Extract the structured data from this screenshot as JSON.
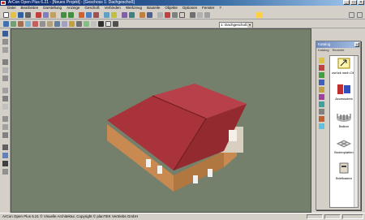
{
  "window": {
    "title": "ArCon Open Plus 6.21 - [Neues Projekt] - [Geschoss 1: Dachgeschoß]"
  },
  "menu": [
    "Datei",
    "Bearbeiten",
    "Darstellung",
    "Anzeige",
    "Geschoß",
    "Verbinden",
    "Werkzeug",
    "Bauteile",
    "Objekte",
    "Optionen",
    "Fenster",
    "?"
  ],
  "toolbar": {
    "floor_select": "1: Dachgeschoß"
  },
  "catalog": {
    "title": "Katalog",
    "close": "×",
    "tabs": [
      "Katalog",
      "Recente"
    ],
    "items": [
      {
        "label": "zurück nach Objekte"
      },
      {
        "label": "Accessoires"
      },
      {
        "label": "Balkon"
      },
      {
        "label": "Bodenplatten"
      },
      {
        "label": "Briefkasten"
      }
    ]
  },
  "status": {
    "text": "ArCon Open Plus 6.21 © Visuelle Architektur, Copyright © planTEK Vertriebs GmbH"
  },
  "colors": {
    "titlebar": "#0a246a",
    "viewport_bg": "#75806c",
    "roof": "#a8333a",
    "wall": "#c98a52"
  }
}
